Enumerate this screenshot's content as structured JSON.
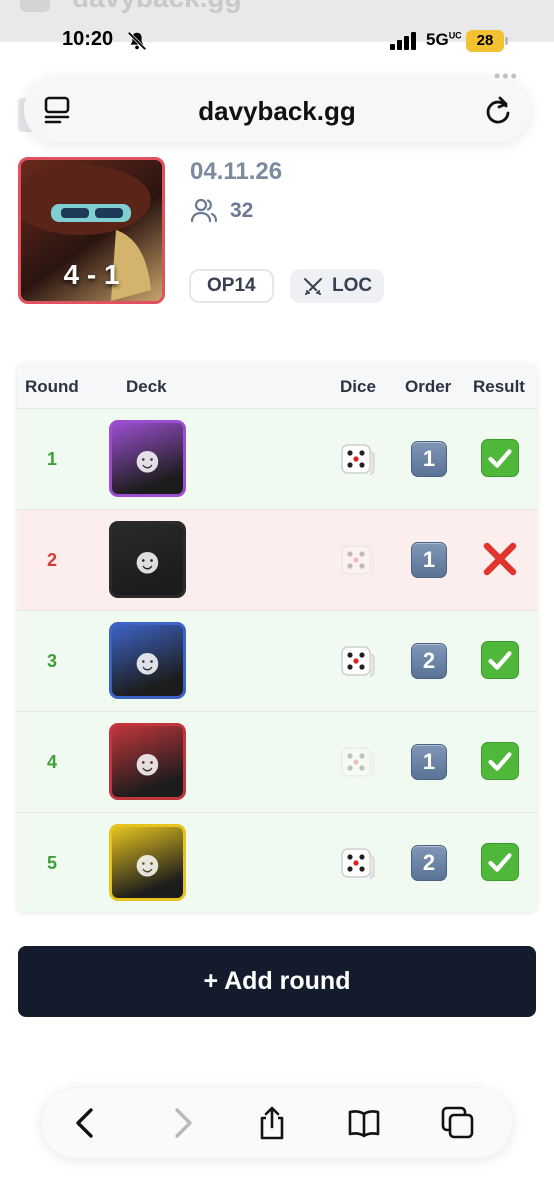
{
  "status_bar": {
    "time": "10:20",
    "network": "5G",
    "network_sub": "UC",
    "battery": "28"
  },
  "browser": {
    "url": "davyback.gg"
  },
  "event": {
    "date": "04.11.26",
    "players": "32",
    "score": "4 - 1",
    "set_tag": "OP14",
    "format_tag": "LOC"
  },
  "table": {
    "headers": {
      "round": "Round",
      "deck": "Deck",
      "dice": "Dice",
      "order": "Order",
      "result": "Result"
    },
    "rows": [
      {
        "round": "1",
        "result": "win",
        "dice_won": true,
        "order": "1",
        "deck_color": "#9b4fd0"
      },
      {
        "round": "2",
        "result": "loss",
        "dice_won": false,
        "order": "1",
        "deck_color": "#2a2a2a"
      },
      {
        "round": "3",
        "result": "win",
        "dice_won": true,
        "order": "2",
        "deck_color": "#3d63c4"
      },
      {
        "round": "4",
        "result": "win",
        "dice_won": false,
        "order": "1",
        "deck_color": "#c0363c"
      },
      {
        "round": "5",
        "result": "win",
        "dice_won": true,
        "order": "2",
        "deck_color": "#e6c31f"
      }
    ]
  },
  "actions": {
    "add_round": "+ Add round"
  },
  "colors": {
    "win": "#3f9e3c",
    "loss": "#d63b36",
    "primary_button": "#141b2d"
  }
}
